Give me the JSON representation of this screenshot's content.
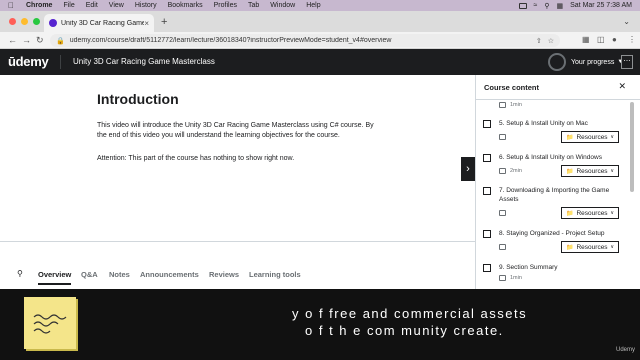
{
  "menubar": {
    "items": [
      "Chrome",
      "File",
      "Edit",
      "View",
      "History",
      "Bookmarks",
      "Profiles",
      "Tab",
      "Window",
      "Help"
    ],
    "datetime": "Sat Mar 25  7:38 AM"
  },
  "browser": {
    "tab_title": "Unity 3D Car Racing Game Ma",
    "url": "udemy.com/course/draft/5112772/learn/lecture/36018340?instructorPreviewMode=student_v4#overview"
  },
  "colors": {
    "traffic_close": "#ff5f57",
    "traffic_min": "#febc2e",
    "traffic_max": "#28c840",
    "udemy_purple": "#5624d0",
    "header_bg": "#1c1d1f"
  },
  "header": {
    "logo": "ūdemy",
    "course_title": "Unity 3D Car Racing Game Masterclass",
    "progress_label": "Your progress",
    "more": "⋯"
  },
  "lesson": {
    "title": "Introduction",
    "body": "This video will introduce the Unity 3D Car Racing Game Masterclass using C# course. By the end of this video you will understand the learning objectives for the course.",
    "note": "Attention: This part of the course has nothing to show right now."
  },
  "tabs": [
    "Overview",
    "Q&A",
    "Notes",
    "Announcements",
    "Reviews",
    "Learning tools"
  ],
  "sidebar": {
    "title": "Course content",
    "top_meta": "1min",
    "lectures": [
      {
        "name": "5. Setup & Install Unity on Mac",
        "meta": "",
        "resources": "Resources"
      },
      {
        "name": "6. Setup & Install Unity on Windows",
        "meta": "2min",
        "resources": "Resources"
      },
      {
        "name": "7. Downloading & Importing the Game Assets",
        "meta": "",
        "resources": "Resources"
      },
      {
        "name": "8. Staying Organized - Project Setup",
        "meta": "",
        "resources": "Resources"
      },
      {
        "name": "9. Section Summary",
        "meta": "1min",
        "resources": ""
      }
    ]
  },
  "caption": {
    "line1": "y o f free and commercial assets",
    "line2": "o f t h e com munity create.",
    "watermark": "Udemy"
  }
}
